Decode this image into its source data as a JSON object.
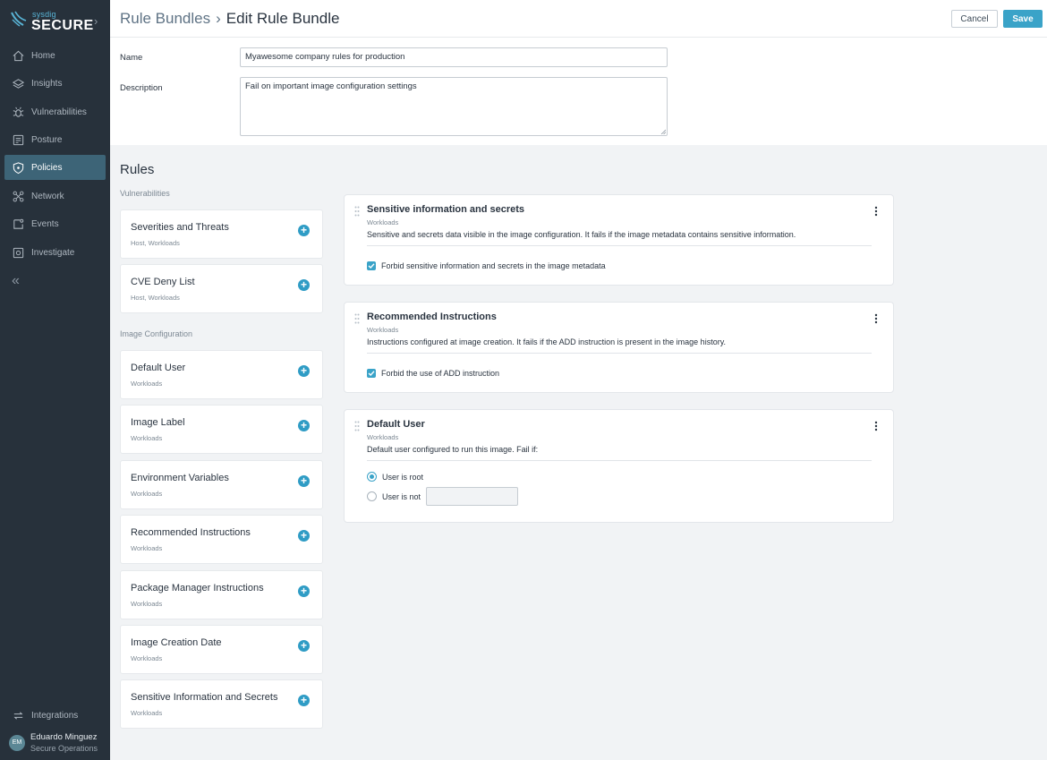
{
  "brand": {
    "small": "sysdig",
    "name": "SECURE"
  },
  "sidebar": {
    "items": [
      {
        "label": "Home",
        "icon": "home-icon"
      },
      {
        "label": "Insights",
        "icon": "insights-icon"
      },
      {
        "label": "Vulnerabilities",
        "icon": "bug-icon"
      },
      {
        "label": "Posture",
        "icon": "posture-icon"
      },
      {
        "label": "Policies",
        "icon": "shield-icon",
        "active": true
      },
      {
        "label": "Network",
        "icon": "network-icon"
      },
      {
        "label": "Events",
        "icon": "events-icon"
      },
      {
        "label": "Investigate",
        "icon": "investigate-icon"
      }
    ],
    "collapse_glyph": "«",
    "integrations_label": "Integrations",
    "user": {
      "initials": "EM",
      "name": "Eduardo Minguez",
      "role": "Secure Operations"
    }
  },
  "header": {
    "breadcrumb_parent": "Rule Bundles",
    "separator": "›",
    "title": "Edit Rule Bundle",
    "cancel_label": "Cancel",
    "save_label": "Save"
  },
  "form": {
    "name_label": "Name",
    "name_value": "Myawesome company rules for production",
    "description_label": "Description",
    "description_value": "Fail on important image configuration settings"
  },
  "rules": {
    "title": "Rules",
    "sections": [
      {
        "label": "Vulnerabilities",
        "items": [
          {
            "title": "Severities and Threats",
            "sub": "Host, Workloads"
          },
          {
            "title": "CVE Deny List",
            "sub": "Host, Workloads"
          }
        ]
      },
      {
        "label": "Image Configuration",
        "items": [
          {
            "title": "Default User",
            "sub": "Workloads"
          },
          {
            "title": "Image Label",
            "sub": "Workloads"
          },
          {
            "title": "Environment Variables",
            "sub": "Workloads"
          },
          {
            "title": "Recommended Instructions",
            "sub": "Workloads"
          },
          {
            "title": "Package Manager Instructions",
            "sub": "Workloads"
          },
          {
            "title": "Image Creation Date",
            "sub": "Workloads"
          },
          {
            "title": "Sensitive Information and Secrets",
            "sub": "Workloads"
          }
        ]
      }
    ]
  },
  "bundle": [
    {
      "title": "Sensitive information and secrets",
      "sub": "Workloads",
      "description": "Sensitive and secrets data visible in the image configuration. It fails if the image metadata contains sensitive information.",
      "option": "Forbid sensitive information and secrets in the image metadata",
      "checked": true
    },
    {
      "title": "Recommended Instructions",
      "sub": "Workloads",
      "description": "Instructions configured at image creation. It fails if the ADD instruction is present in the image history.",
      "option": "Forbid the use of ADD instruction",
      "checked": true
    },
    {
      "title": "Default User",
      "sub": "Workloads",
      "description": "Default user configured to run this image. Fail if:",
      "radio_root": "User is root",
      "radio_not": "User is not",
      "selected": "User is root",
      "user_value": ""
    }
  ],
  "colors": {
    "accent": "#3aa3c8",
    "sidebar": "#27313b",
    "active_nav": "#3d6477"
  }
}
